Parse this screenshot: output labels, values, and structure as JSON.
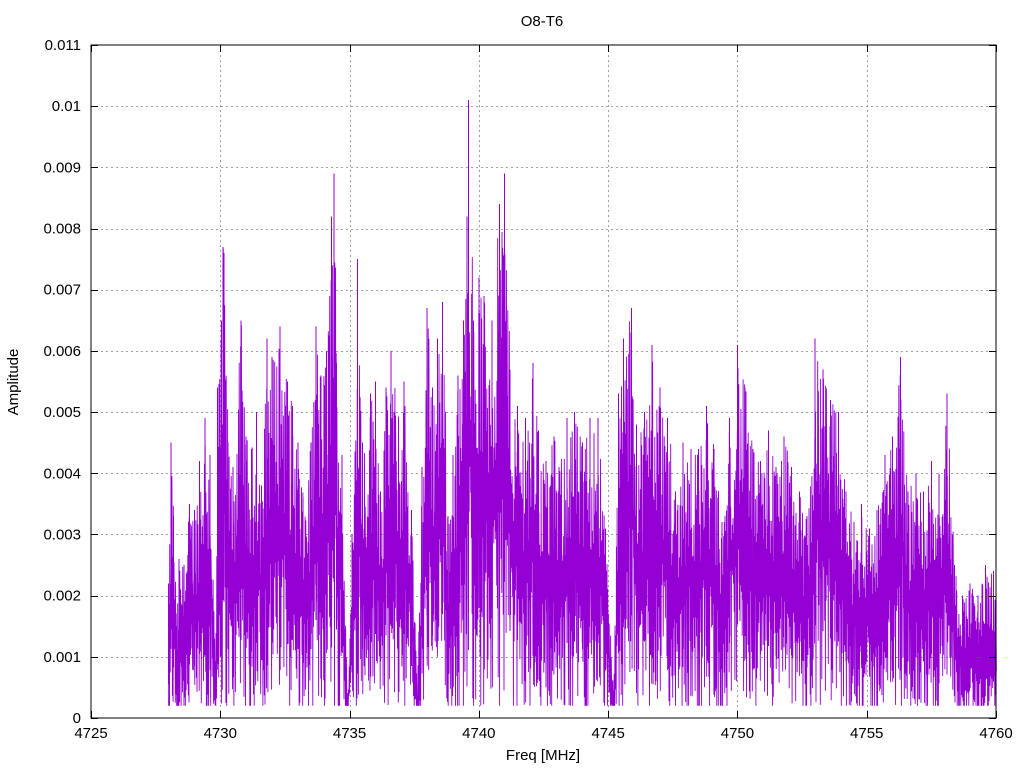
{
  "chart_data": {
    "type": "line",
    "title": "O8-T6",
    "xlabel": "Freq [MHz]",
    "ylabel": "Amplitude",
    "xlim": [
      4725,
      4760
    ],
    "ylim": [
      0,
      0.011
    ],
    "x_ticks": [
      4725,
      4730,
      4735,
      4740,
      4745,
      4750,
      4755,
      4760
    ],
    "x_tick_labels": [
      "4725",
      "4730",
      "4735",
      "4740",
      "4745",
      "4750",
      "4755",
      "4760"
    ],
    "y_ticks": [
      0,
      0.001,
      0.002,
      0.003,
      0.004,
      0.005,
      0.006,
      0.007,
      0.008,
      0.009,
      0.01,
      0.011
    ],
    "y_tick_labels": [
      "0",
      "0.001",
      "0.002",
      "0.003",
      "0.004",
      "0.005",
      "0.006",
      "0.007",
      "0.008",
      "0.009",
      "0.01",
      "0.011"
    ],
    "grid": true,
    "legend": "none",
    "series": [
      {
        "color": "#9400d3",
        "points": [
          [
            4728.0,
            0.0022
          ],
          [
            4728.1,
            0.0045
          ],
          [
            4728.2,
            0.0033
          ],
          [
            4728.3,
            0.0015
          ],
          [
            4728.4,
            0.0026
          ],
          [
            4728.6,
            0.0025
          ],
          [
            4728.8,
            0.0035
          ],
          [
            4729.0,
            0.0034
          ],
          [
            4729.2,
            0.0042
          ],
          [
            4729.4,
            0.0049
          ],
          [
            4729.6,
            0.0043
          ],
          [
            4729.8,
            0.0009
          ],
          [
            4729.9,
            0.0054
          ],
          [
            4730.05,
            0.0065
          ],
          [
            4730.1,
            0.0077
          ],
          [
            4730.15,
            0.0076
          ],
          [
            4730.3,
            0.0045
          ],
          [
            4730.5,
            0.0041
          ],
          [
            4730.8,
            0.0065
          ],
          [
            4731.0,
            0.0046
          ],
          [
            4731.2,
            0.0044
          ],
          [
            4731.4,
            0.005
          ],
          [
            4731.6,
            0.0038
          ],
          [
            4731.8,
            0.0062
          ],
          [
            4732.0,
            0.0059
          ],
          [
            4732.3,
            0.0064
          ],
          [
            4732.6,
            0.0055
          ],
          [
            4732.8,
            0.0051
          ],
          [
            4733.0,
            0.0045
          ],
          [
            4733.2,
            0.0036
          ],
          [
            4733.5,
            0.0045
          ],
          [
            4733.7,
            0.0064
          ],
          [
            4733.9,
            0.0056
          ],
          [
            4734.1,
            0.006
          ],
          [
            4734.3,
            0.0082
          ],
          [
            4734.4,
            0.0089
          ],
          [
            4734.5,
            0.0058
          ],
          [
            4734.7,
            0.0043
          ],
          [
            4734.9,
            0.0002
          ],
          [
            4735.1,
            0.003
          ],
          [
            4735.3,
            0.0075
          ],
          [
            4735.5,
            0.0045
          ],
          [
            4735.8,
            0.0053
          ],
          [
            4736.0,
            0.0055
          ],
          [
            4736.2,
            0.0037
          ],
          [
            4736.4,
            0.0054
          ],
          [
            4736.6,
            0.006
          ],
          [
            4736.9,
            0.0049
          ],
          [
            4737.1,
            0.0055
          ],
          [
            4737.4,
            0.0034
          ],
          [
            4737.6,
            0.0004
          ],
          [
            4737.8,
            0.0041
          ],
          [
            4738.0,
            0.0067
          ],
          [
            4738.2,
            0.0054
          ],
          [
            4738.4,
            0.0062
          ],
          [
            4738.6,
            0.0068
          ],
          [
            4738.8,
            0.0033
          ],
          [
            4739.0,
            0.0043
          ],
          [
            4739.2,
            0.0056
          ],
          [
            4739.4,
            0.0065
          ],
          [
            4739.55,
            0.0082
          ],
          [
            4739.6,
            0.0101
          ],
          [
            4739.8,
            0.0065
          ],
          [
            4740.0,
            0.0072
          ],
          [
            4740.2,
            0.0069
          ],
          [
            4740.5,
            0.0065
          ],
          [
            4740.8,
            0.0084
          ],
          [
            4741.0,
            0.0089
          ],
          [
            4741.2,
            0.0057
          ],
          [
            4741.5,
            0.0051
          ],
          [
            4741.8,
            0.0049
          ],
          [
            4742.1,
            0.0058
          ],
          [
            4742.3,
            0.0047
          ],
          [
            4742.6,
            0.0042
          ],
          [
            4742.9,
            0.0046
          ],
          [
            4743.1,
            0.0041
          ],
          [
            4743.4,
            0.0049
          ],
          [
            4743.7,
            0.005
          ],
          [
            4744.0,
            0.0045
          ],
          [
            4744.3,
            0.0049
          ],
          [
            4744.6,
            0.0049
          ],
          [
            4744.9,
            0.0031
          ],
          [
            4745.2,
            0.0004
          ],
          [
            4745.4,
            0.0053
          ],
          [
            4745.6,
            0.0062
          ],
          [
            4745.9,
            0.0067
          ],
          [
            4746.1,
            0.0048
          ],
          [
            4746.4,
            0.005
          ],
          [
            4746.7,
            0.0061
          ],
          [
            4747.0,
            0.0054
          ],
          [
            4747.3,
            0.0049
          ],
          [
            4747.6,
            0.0037
          ],
          [
            4747.9,
            0.0045
          ],
          [
            4748.2,
            0.0044
          ],
          [
            4748.5,
            0.0044
          ],
          [
            4748.8,
            0.0051
          ],
          [
            4749.1,
            0.0044
          ],
          [
            4749.4,
            0.0032
          ],
          [
            4749.7,
            0.0049
          ],
          [
            4750.0,
            0.0061
          ],
          [
            4750.3,
            0.0054
          ],
          [
            4750.6,
            0.0044
          ],
          [
            4750.9,
            0.0042
          ],
          [
            4751.2,
            0.0047
          ],
          [
            4751.5,
            0.0041
          ],
          [
            4751.8,
            0.0046
          ],
          [
            4752.1,
            0.0041
          ],
          [
            4752.4,
            0.0037
          ],
          [
            4752.7,
            0.0033
          ],
          [
            4753.0,
            0.0062
          ],
          [
            4753.3,
            0.0057
          ],
          [
            4753.6,
            0.0052
          ],
          [
            4753.9,
            0.005
          ],
          [
            4754.2,
            0.0037
          ],
          [
            4754.5,
            0.0032
          ],
          [
            4754.8,
            0.0035
          ],
          [
            4755.1,
            0.0031
          ],
          [
            4755.4,
            0.0034
          ],
          [
            4755.7,
            0.0043
          ],
          [
            4756.0,
            0.0046
          ],
          [
            4756.3,
            0.0059
          ],
          [
            4756.6,
            0.0037
          ],
          [
            4756.9,
            0.004
          ],
          [
            4757.2,
            0.0037
          ],
          [
            4757.5,
            0.0042
          ],
          [
            4757.8,
            0.004
          ],
          [
            4758.1,
            0.0053
          ],
          [
            4758.4,
            0.0025
          ],
          [
            4758.7,
            0.002
          ],
          [
            4759.0,
            0.0022
          ],
          [
            4759.3,
            0.002
          ],
          [
            4759.6,
            0.0025
          ],
          [
            4759.9,
            0.0024
          ],
          [
            4760.0,
            0.0018
          ]
        ]
      }
    ]
  }
}
